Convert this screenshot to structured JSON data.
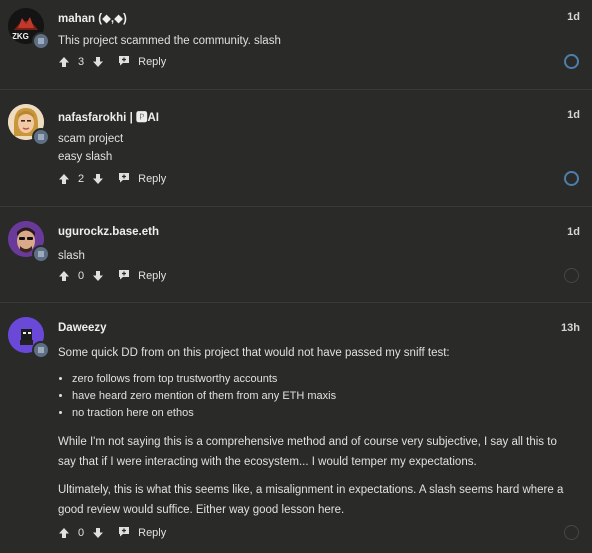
{
  "comments": [
    {
      "author": "mahan (◆,◆)",
      "time": "1d",
      "text_lines": [
        "This project scammed the community. slash"
      ],
      "votes": "3",
      "reply_label": "Reply",
      "avatar_label": "ZKG",
      "status": "blue"
    },
    {
      "author": "nafasfarokhi | 🅿AI",
      "time": "1d",
      "text_lines": [
        "scam project",
        "easy slash"
      ],
      "votes": "2",
      "reply_label": "Reply",
      "status": "blue"
    },
    {
      "author": "ugurockz.base.eth",
      "time": "1d",
      "text_lines": [
        "slash"
      ],
      "votes": "0",
      "reply_label": "Reply",
      "status": "grey"
    },
    {
      "author": "Daweezy",
      "time": "13h",
      "intro": "Some quick DD from on this project that would not have passed my sniff test:",
      "bullets": [
        "zero follows from top trustworthy accounts",
        "have heard zero mention of them from any ETH maxis",
        "no traction here on ethos"
      ],
      "para2": "While I'm not saying this is a comprehensive method and of course very subjective, I say all this to say that if I were interacting with the ecosystem... I would temper my expectations.",
      "para3": "Ultimately, this is what this seems like, a misalignment in expectations. A slash seems hard where a good review would suffice. Either way good lesson here.",
      "votes": "0",
      "reply_label": "Reply",
      "status": "grey"
    }
  ],
  "colors": {
    "background": "#2a2a28",
    "accent_ring": "#4c7fae",
    "chain_badge": "#5d6f85"
  }
}
